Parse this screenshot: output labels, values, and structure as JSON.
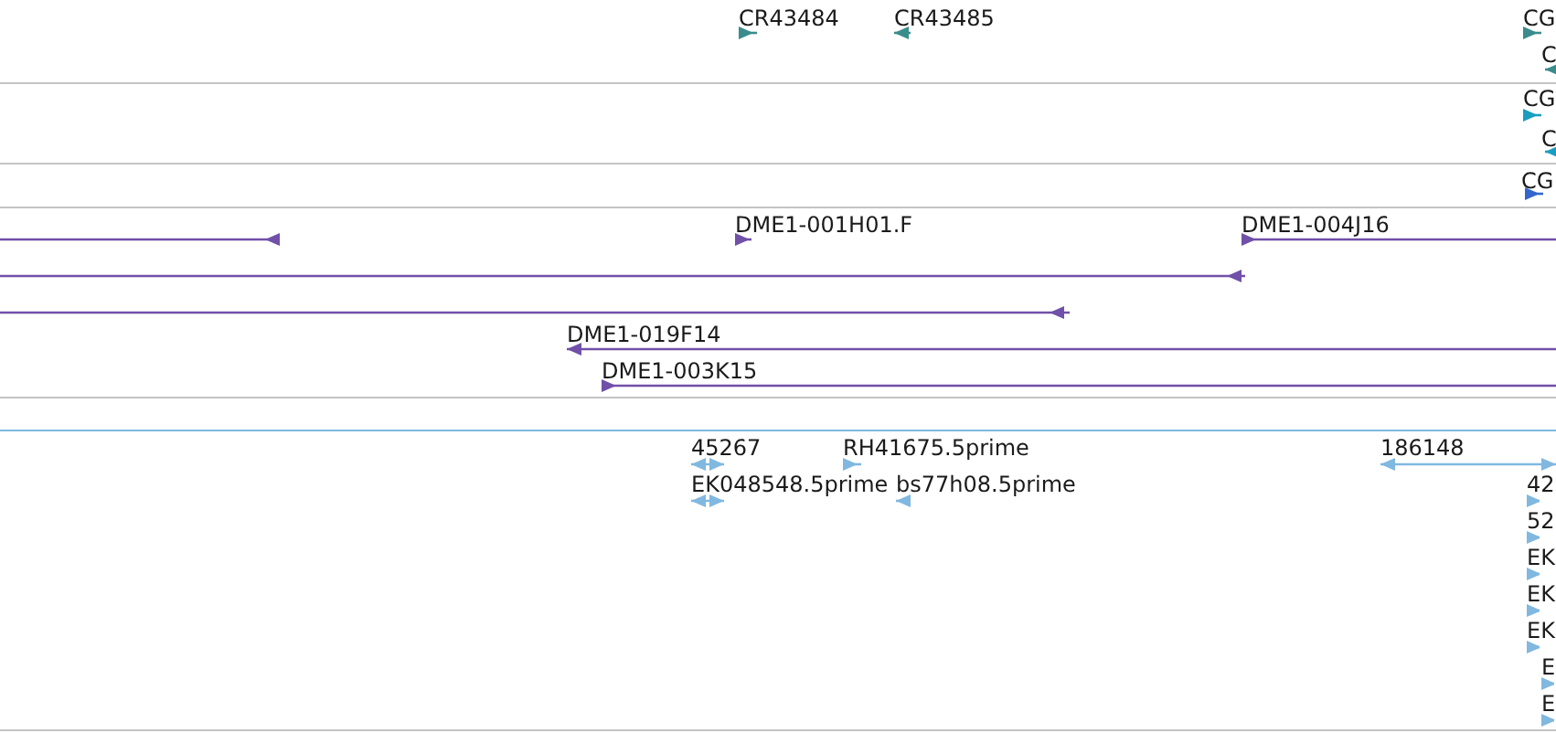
{
  "tracks": [
    {
      "color": "#3a8c8c",
      "features": [
        {
          "label": "CR43484",
          "kind": "forward"
        },
        {
          "label": "CR43485",
          "kind": "reverse"
        },
        {
          "label": "CG",
          "kind": "forward"
        },
        {
          "label": "C",
          "kind": "reverse"
        }
      ]
    },
    {
      "color": "#1a9ec0",
      "features": [
        {
          "label": "CG",
          "kind": "forward"
        },
        {
          "label": "C",
          "kind": "reverse"
        }
      ]
    },
    {
      "color": "#3366cc",
      "features": [
        {
          "label": "CG",
          "kind": "forward"
        }
      ]
    },
    {
      "color": "#7050a8",
      "features": [
        {
          "kind": "reverse"
        },
        {
          "label": "DME1-001H01.F",
          "kind": "forward"
        },
        {
          "label": "DME1-004J16",
          "kind": "forward"
        },
        {
          "kind": "reverse"
        },
        {
          "kind": "reverse"
        },
        {
          "label": "DME1-019F14",
          "kind": "reverse"
        },
        {
          "label": "DME1-003K15",
          "kind": "forward"
        }
      ]
    },
    {
      "color": "#80b8e0",
      "features": [
        {
          "label": "45267",
          "kind": "both"
        },
        {
          "label": "RH41675.5prime",
          "kind": "forward"
        },
        {
          "label": "186148",
          "kind": "both"
        },
        {
          "label": "EK048548.5prime",
          "kind": "both"
        },
        {
          "label": "bs77h08.5prime",
          "kind": "reverse"
        },
        {
          "label": "42",
          "kind": "forward"
        },
        {
          "label": "52",
          "kind": "forward"
        },
        {
          "label": "EK",
          "kind": "forward"
        },
        {
          "label": "EK",
          "kind": "forward"
        },
        {
          "label": "EK",
          "kind": "forward"
        },
        {
          "label": "E",
          "kind": "forward"
        },
        {
          "label": "E",
          "kind": "forward"
        }
      ]
    }
  ]
}
